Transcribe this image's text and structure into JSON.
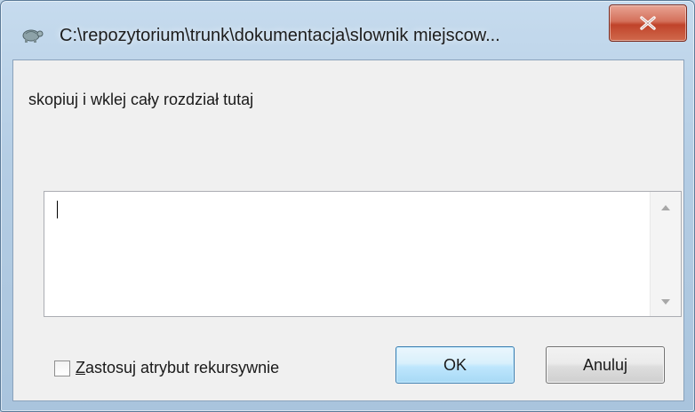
{
  "window": {
    "title": "C:\\repozytorium\\trunk\\dokumentacja\\slownik miejscow...",
    "app_icon": "tortoise-icon",
    "close_icon": "close-icon"
  },
  "dialog": {
    "prompt": "skopiuj i wklej cały rozdział tutaj",
    "text_value": "",
    "recursive_checkbox": {
      "mnemonic": "Z",
      "label_rest": "astosuj atrybut rekursywnie",
      "checked": false
    },
    "ok_label": "OK",
    "cancel_label": "Anuluj"
  },
  "colors": {
    "close_button": "#c7462d",
    "default_button_border": "#3c7fb1",
    "window_frame": "#b4cde4"
  }
}
